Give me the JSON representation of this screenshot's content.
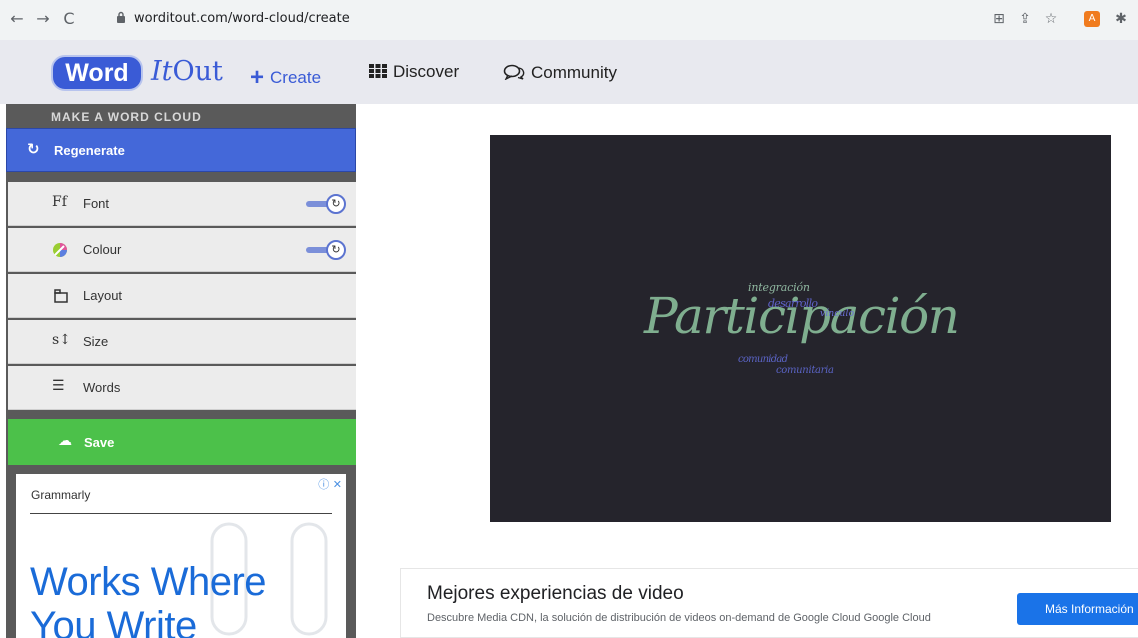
{
  "browser": {
    "url": "worditout.com/word-cloud/create"
  },
  "header": {
    "logo_word": "Word",
    "logo_it": "It",
    "logo_out": "Out",
    "nav": [
      {
        "label": "Create",
        "icon": "plus-icon"
      },
      {
        "label": "Discover",
        "icon": "grid-icon"
      },
      {
        "label": "Community",
        "icon": "chat-icon"
      }
    ]
  },
  "sidebar": {
    "title": "MAKE A WORD CLOUD",
    "regenerate": "Regenerate",
    "items": [
      {
        "label": "Font",
        "icon_text": "Ff",
        "toggle": true
      },
      {
        "label": "Colour",
        "icon_text": "🎨",
        "toggle": true
      },
      {
        "label": "Layout",
        "icon_text": "⧉",
        "toggle": false
      },
      {
        "label": "Size",
        "icon_text": "s↕",
        "toggle": false
      },
      {
        "label": "Words",
        "icon_text": "☰",
        "toggle": false
      }
    ],
    "save": "Save"
  },
  "ad": {
    "brand": "Grammarly",
    "headline_1": "Works Where",
    "headline_2": "You Write"
  },
  "cloud": {
    "background": "#25242c",
    "words": [
      {
        "text": "Participación",
        "color": "#7fae8f"
      },
      {
        "text": "integración",
        "color": "#8fb7a0"
      },
      {
        "text": "desarrollo",
        "color": "#5e62c8"
      },
      {
        "text": "vínculo",
        "color": "#6a6fd6"
      },
      {
        "text": "comunidad",
        "color": "#5a63c4"
      },
      {
        "text": "comunitaria",
        "color": "#5a63c4"
      }
    ]
  },
  "bottom_ad": {
    "title": "Mejores experiencias de video",
    "description": "Descubre Media CDN, la solución de distribución de videos on-demand de Google Cloud Google Cloud",
    "button": "Más Información"
  }
}
